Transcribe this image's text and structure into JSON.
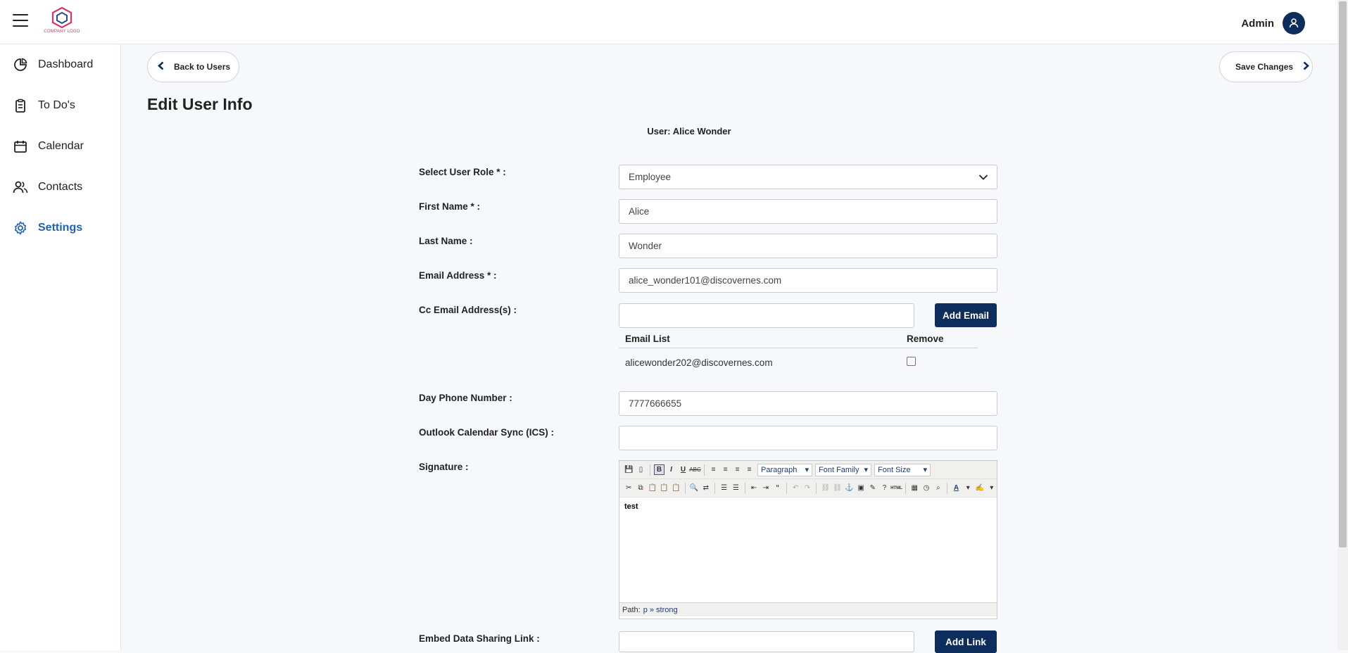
{
  "header": {
    "logo_text": "COMPANY LOGO",
    "admin_label": "Admin"
  },
  "sidebar": {
    "items": [
      {
        "label": "Dashboard",
        "icon": "pie-chart-icon"
      },
      {
        "label": "To Do's",
        "icon": "clipboard-icon"
      },
      {
        "label": "Calendar",
        "icon": "calendar-icon"
      },
      {
        "label": "Contacts",
        "icon": "users-icon"
      },
      {
        "label": "Settings",
        "icon": "gear-icon",
        "active": true
      }
    ]
  },
  "main": {
    "back_label": "Back to Users",
    "save_label": "Save Changes",
    "title": "Edit User Info",
    "user_line": "User: Alice Wonder"
  },
  "form": {
    "role_label": "Select User Role * :",
    "role_value": "Employee",
    "first_label": "First Name * :",
    "first_value": "Alice",
    "last_label": "Last Name :",
    "last_value": "Wonder",
    "email_label": "Email Address * :",
    "email_value": "alice_wonder101@discovernes.com",
    "cc_label": "Cc Email Address(s) :",
    "cc_value": "",
    "add_email_label": "Add Email",
    "email_list_header": "Email List",
    "remove_header": "Remove",
    "email_list": [
      {
        "email": "alicewonder202@discovernes.com",
        "remove": false
      }
    ],
    "phone_label": "Day Phone Number :",
    "phone_value": "7777666655",
    "ics_label": "Outlook Calendar Sync (ICS) :",
    "ics_value": "",
    "signature_label": "Signature :",
    "embed_label": "Embed Data Sharing Link :",
    "embed_value": "",
    "add_link_label": "Add Link"
  },
  "editor": {
    "format_select": "Paragraph",
    "font_family_select": "Font Family",
    "font_size_select": "Font Size",
    "content": "test",
    "path_label": "Path:",
    "path_value": "p » strong"
  },
  "colors": {
    "navy": "#0d2e5c",
    "active_nav": "#1f63b4",
    "logo_accent": "#d0386a"
  }
}
